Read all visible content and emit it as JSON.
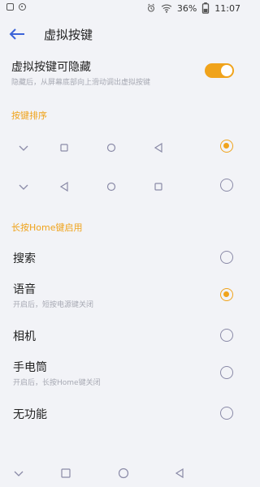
{
  "status": {
    "battery": "36%",
    "time": "11:07"
  },
  "appbar": {
    "title": "虚拟按键"
  },
  "virtual_keys": {
    "title": "虚拟按键可隐藏",
    "subtitle": "隐藏后，从屏幕底部向上滑动调出虚拟按键",
    "enabled": true
  },
  "order_section": {
    "header": "按键排序",
    "options": [
      {
        "icons": [
          "chevron-down-icon",
          "square-icon",
          "circle-icon",
          "triangle-left-icon"
        ],
        "selected": true
      },
      {
        "icons": [
          "chevron-down-icon",
          "triangle-left-icon",
          "circle-icon",
          "square-icon"
        ],
        "selected": false
      }
    ]
  },
  "home_section": {
    "header": "长按Home键启用",
    "items": [
      {
        "label": "搜索",
        "sub": "",
        "selected": false
      },
      {
        "label": "语音",
        "sub": "开启后，短按电源键关闭",
        "selected": true
      },
      {
        "label": "相机",
        "sub": "",
        "selected": false
      },
      {
        "label": "手电筒",
        "sub": "开启后，长按Home键关闭",
        "selected": false
      },
      {
        "label": "无功能",
        "sub": "",
        "selected": false
      }
    ]
  },
  "colors": {
    "accent": "#f0a31b",
    "icon": "#8a8aa7",
    "background": "#f2f3f7"
  }
}
